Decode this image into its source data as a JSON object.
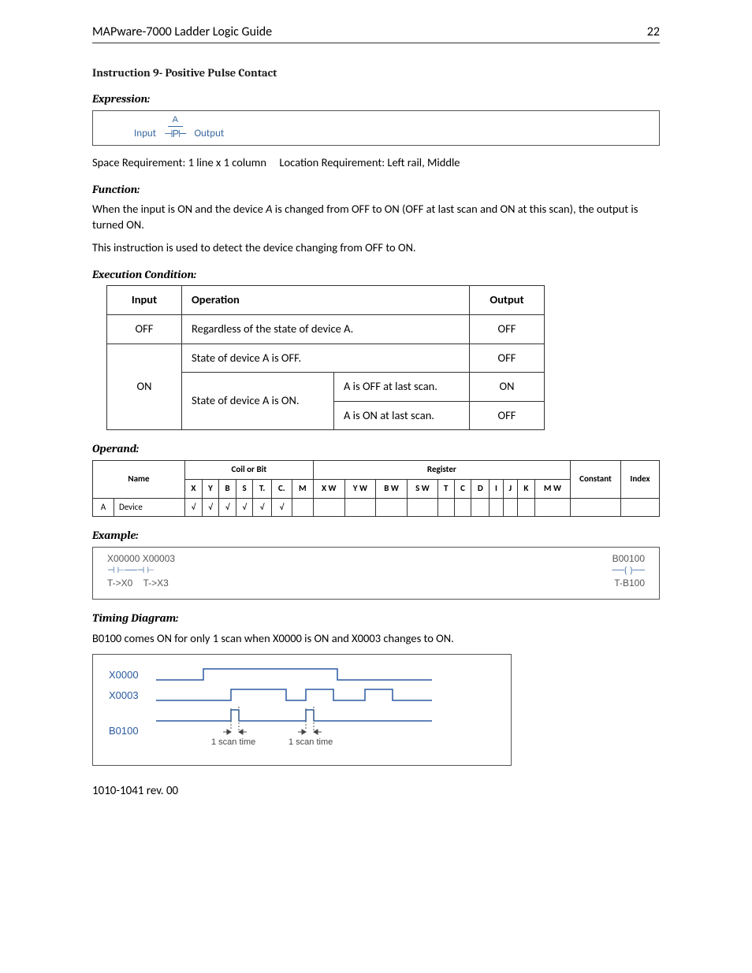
{
  "header": {
    "title": "MAPware-7000 Ladder Logic Guide",
    "page": "22"
  },
  "instruction": {
    "heading": "Instruction 9- Positive Pulse Contact"
  },
  "expression": {
    "label": "Expression:",
    "a_label": "A",
    "input_label": "Input",
    "symbol": "⊣P⊢",
    "output_label": "Output"
  },
  "space_location": "Space Requirement: 1 line x 1 column     Location Requirement: Left rail, Middle",
  "function": {
    "label": "Function:",
    "p1a": "When the input is ON and the device ",
    "p1b": "A",
    "p1c": " is changed from OFF to ON (OFF at last scan and ON at this scan), the output is turned ON.",
    "p2": "This instruction is used to detect the device changing from OFF to ON."
  },
  "exec": {
    "label": "Execution Condition:",
    "headers": [
      "Input",
      "Operation",
      "Output"
    ],
    "rows": [
      {
        "input": "OFF",
        "op": "Regardless of the state of device A.",
        "out": "OFF"
      },
      {
        "op": "State of device A is OFF.",
        "out": "OFF"
      },
      {
        "input": "ON",
        "op": "State of device A is ON.",
        "cond": "A is OFF at last scan.",
        "out": "ON"
      },
      {
        "cond": "A is ON at last scan.",
        "out": "OFF"
      }
    ]
  },
  "operand": {
    "label": "Operand:",
    "group_headers": {
      "name": "Name",
      "coil": "Coil or Bit",
      "reg": "Register",
      "const": "Constant",
      "index": "Index"
    },
    "cols": [
      "X",
      "Y",
      "B",
      "S",
      "T.",
      "C.",
      "M",
      "X W",
      "Y W",
      "B W",
      "S W",
      "T",
      "C",
      "D",
      "I",
      "J",
      "K",
      "M W"
    ],
    "row": {
      "key": "A",
      "label": "Device",
      "vals": [
        "√",
        "√",
        "√",
        "√",
        "√",
        "√",
        "",
        "",
        "",
        "",
        "",
        "",
        "",
        "",
        "",
        "",
        "",
        ""
      ]
    }
  },
  "example": {
    "label": "Example:",
    "left_top": "X00000 X00003",
    "left_bot": "T->X0    T->X3",
    "right_top": "B00100",
    "right_bot": "T-B100"
  },
  "timing": {
    "label": "Timing Diagram:",
    "desc": "B0100 comes ON for only 1 scan when X0000 is ON and X0003 changes to ON.",
    "labels": [
      "X0000",
      "X0003",
      "B0100"
    ],
    "scan": "1 scan time",
    "scan2": "1 scan time"
  },
  "footer": "1010-1041 rev. 00"
}
